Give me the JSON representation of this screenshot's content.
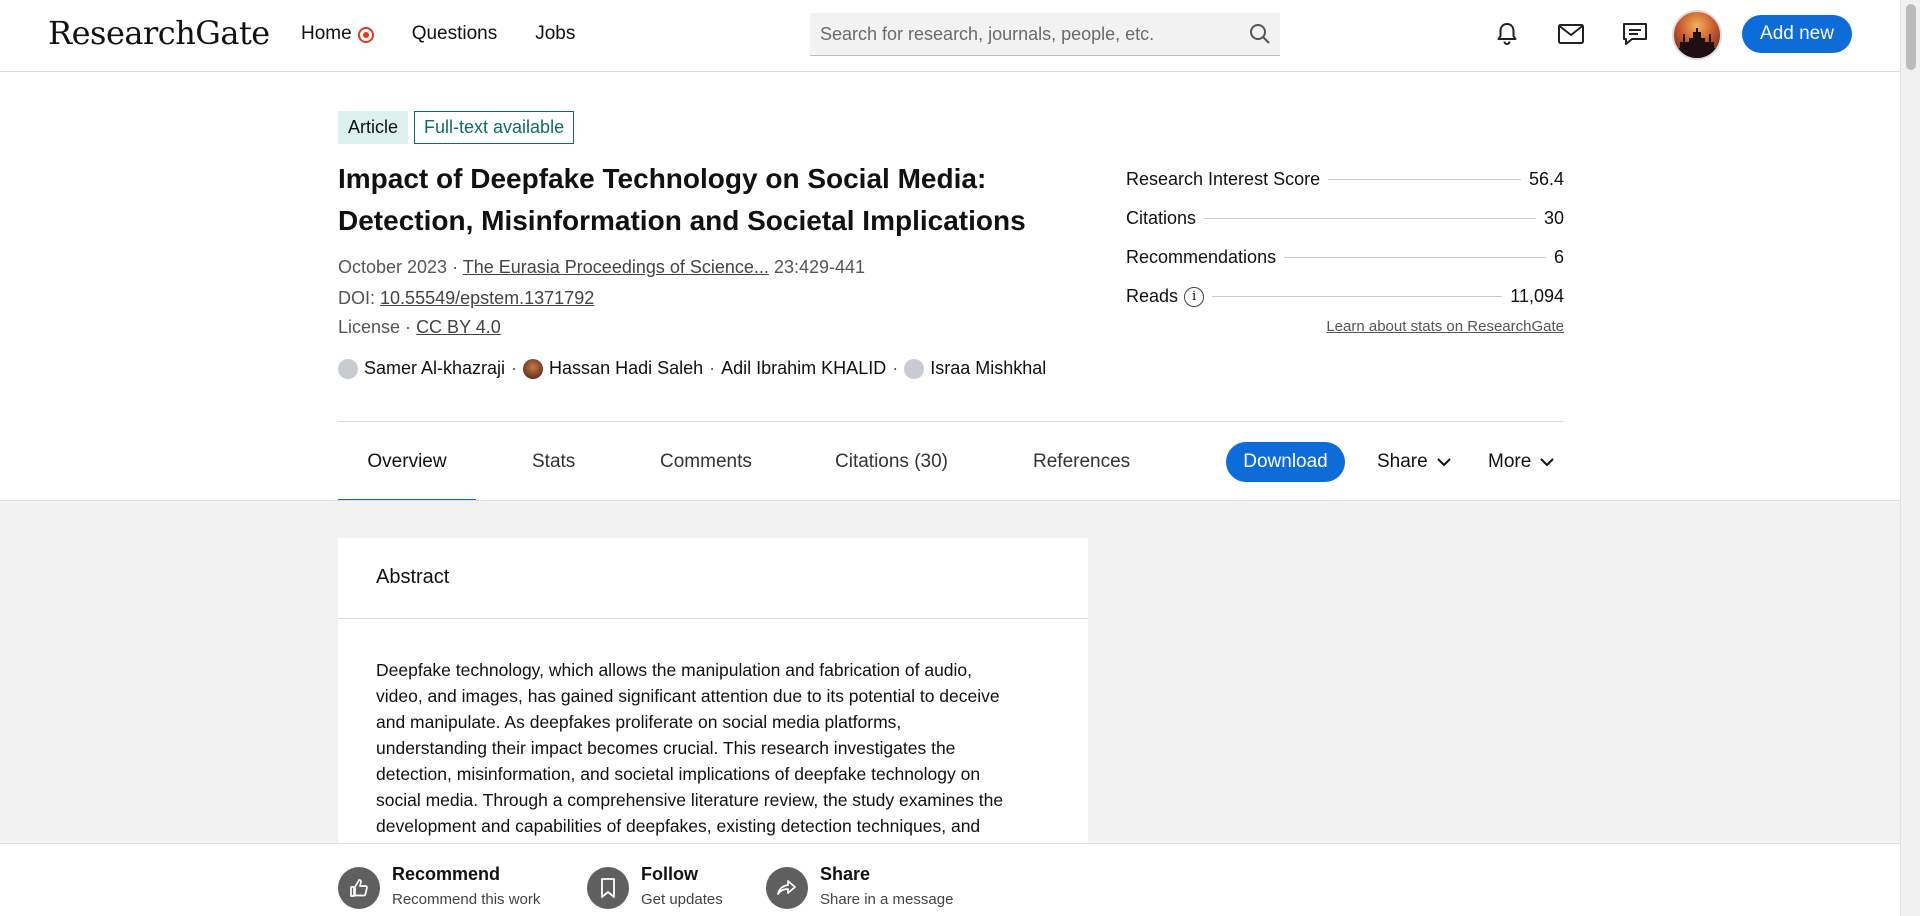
{
  "nav": {
    "logo": "ResearchGate",
    "links": [
      "Home",
      "Questions",
      "Jobs"
    ],
    "search_placeholder": "Search for research, journals, people, etc.",
    "add_new": "Add new"
  },
  "badges": {
    "article": "Article",
    "fulltext": "Full-text available"
  },
  "publication": {
    "title": "Impact of Deepfake Technology on Social Media: Detection, Misinformation and Societal Implications",
    "date": "October 2023",
    "journal": "The Eurasia Proceedings of Science...",
    "pages": "23:429-441",
    "doi_label": "DOI:",
    "doi": "10.55549/epstem.1371792",
    "license_label": "License ·",
    "license": "CC BY 4.0",
    "authors": [
      "Samer Al-khazraji",
      "Hassan Hadi Saleh",
      "Adil Ibrahim KHALID",
      "Israa Mishkhal"
    ]
  },
  "stats": {
    "rows": [
      {
        "label": "Research Interest Score",
        "value": "56.4"
      },
      {
        "label": "Citations",
        "value": "30"
      },
      {
        "label": "Recommendations",
        "value": "6"
      },
      {
        "label": "Reads",
        "value": "11,094"
      }
    ],
    "learn_link": "Learn about stats on ResearchGate"
  },
  "tabs": {
    "items": [
      "Overview",
      "Stats",
      "Comments",
      "Citations (30)",
      "References"
    ],
    "active": "Overview",
    "download": "Download",
    "share": "Share",
    "more": "More"
  },
  "abstract": {
    "heading": "Abstract",
    "lines": [
      "Deepfake technology, which allows the manipulation and fabrication of audio,",
      "video, and images, has gained significant attention due to its potential to deceive",
      "and manipulate. As deepfakes proliferate on social media platforms,",
      "understanding their impact becomes crucial. This research investigates the",
      "detection, misinformation, and societal implications of deepfake technology on",
      "social media. Through a comprehensive literature review, the study examines the",
      "development and capabilities of deepfakes, existing detection techniques, and"
    ]
  },
  "actions": [
    {
      "title": "Recommend",
      "subtitle": "Recommend this work",
      "icon": "thumbs-up-icon"
    },
    {
      "title": "Follow",
      "subtitle": "Get updates",
      "icon": "bookmark-icon"
    },
    {
      "title": "Share",
      "subtitle": "Share in a message",
      "icon": "share-arrow-icon"
    }
  ],
  "colors": {
    "accent": "#0d6cd8",
    "badge_teal": "#0e6e5e",
    "badge_bg": "#dcf0ee",
    "home_dot": "#dd3a1e"
  }
}
